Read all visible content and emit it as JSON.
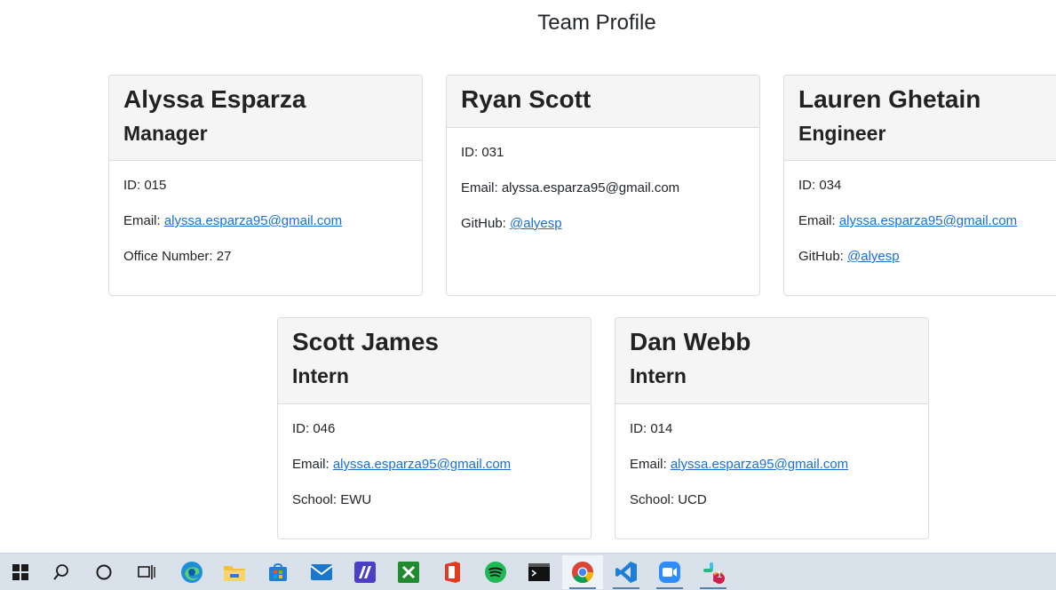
{
  "page": {
    "title": "Team Profile"
  },
  "cards": [
    {
      "name": "Alyssa Esparza",
      "role": "Manager",
      "id_text": "ID: 015",
      "email_label": "Email: ",
      "email": "alyssa.esparza95@gmail.com",
      "extra_label": "Office Number: 27",
      "extra_link": ""
    },
    {
      "name": "Ryan Scott",
      "role": "",
      "id_text": "ID: 031",
      "email_label": "Email: alyssa.esparza95@gmail.com",
      "email": "",
      "extra_label": "GitHub: ",
      "extra_link": "@alyesp"
    },
    {
      "name": "Lauren Ghetain",
      "role": "Engineer",
      "id_text": "ID: 034",
      "email_label": "Email: ",
      "email": "alyssa.esparza95@gmail.com",
      "extra_label": "GitHub: ",
      "extra_link": "@alyesp"
    },
    {
      "name": "Scott James",
      "role": "Intern",
      "id_text": "ID: 046",
      "email_label": "Email: ",
      "email": "alyssa.esparza95@gmail.com",
      "extra_label": "School: EWU",
      "extra_link": ""
    },
    {
      "name": "Dan Webb",
      "role": "Intern",
      "id_text": "ID: 014",
      "email_label": "Email: ",
      "email": "alyssa.esparza95@gmail.com",
      "extra_label": "School: UCD",
      "extra_link": ""
    }
  ],
  "taskbar": {
    "items": [
      "windows-start",
      "search",
      "cortana",
      "task-view",
      "edge",
      "file-explorer",
      "microsoft-store",
      "mail",
      "visual-studio",
      "xbox",
      "office",
      "spotify",
      "terminal",
      "chrome",
      "vscode",
      "zoom",
      "slack"
    ],
    "slack_badge": "1"
  },
  "colors": {
    "link": "#1a6fd4",
    "card_header_bg": "#f5f5f5",
    "taskbar_bg": "#d9e2ea"
  }
}
